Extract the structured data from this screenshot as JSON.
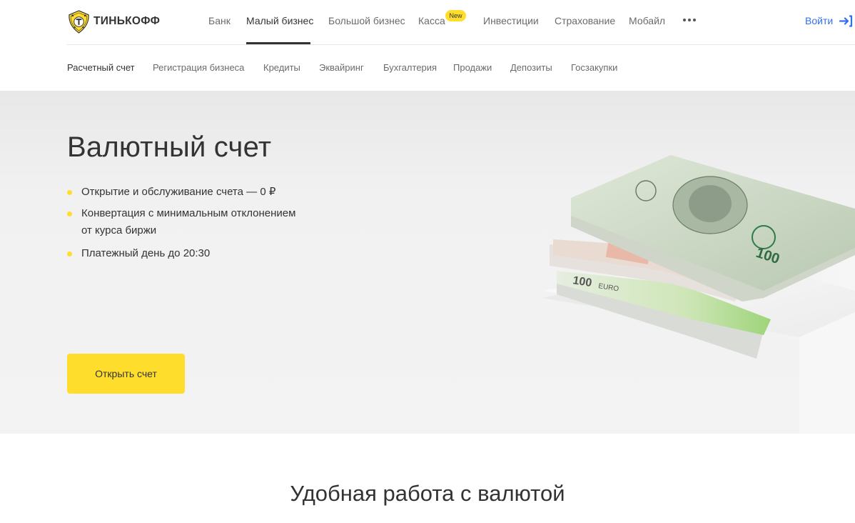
{
  "brand": {
    "name": "ТИНЬКОФФ",
    "accent_color": "#ffdd2d",
    "link_color": "#336fee"
  },
  "topnav": {
    "items": [
      {
        "label": "Банк"
      },
      {
        "label": "Малый бизнес"
      },
      {
        "label": "Большой бизнес"
      },
      {
        "label": "Касса"
      },
      {
        "label": "Инвестиции"
      },
      {
        "label": "Страхование"
      },
      {
        "label": "Мобайл"
      }
    ],
    "active_item": "Малый бизнес",
    "new_badge": "New",
    "more_icon": "more-dots-icon",
    "login_label": "Войти",
    "login_icon": "login-arrow-icon"
  },
  "subnav": {
    "items": [
      {
        "label": "Расчетный счет"
      },
      {
        "label": "Регистрация бизнеса"
      },
      {
        "label": "Кредиты"
      },
      {
        "label": "Эквайринг"
      },
      {
        "label": "Бухгалтерия"
      },
      {
        "label": "Продажи"
      },
      {
        "label": "Депозиты"
      },
      {
        "label": "Госзакупки"
      }
    ],
    "active_item": "Расчетный счет"
  },
  "hero": {
    "title": "Валютный счет",
    "features": [
      "Открытие и обслуживание счета — 0 ₽",
      "Конвертация с минимальным отклонением от курса биржи",
      "Платежный день до 20:30"
    ],
    "cta_label": "Открыть счет",
    "image_icon": "currency-banknotes-image",
    "banknote_labels": {
      "usd": "100",
      "eur": "100",
      "eur_currency": "EURO"
    }
  },
  "section": {
    "title": "Удобная работа с валютой"
  }
}
